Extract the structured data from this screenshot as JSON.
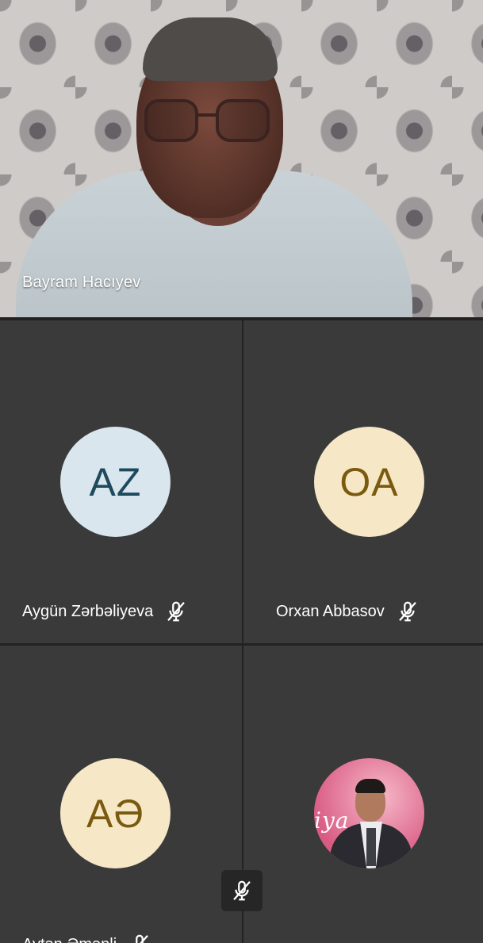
{
  "main_speaker": {
    "name": "Bayram Hacıyev"
  },
  "participants": [
    {
      "initials": "AZ",
      "name": "Aygün Zərbəliyeva",
      "avatar_bg": "#d9e6ed",
      "avatar_fg": "#1e4a5e",
      "muted": true
    },
    {
      "initials": "OA",
      "name": "Orxan Abbasov",
      "avatar_bg": "#f6e7c6",
      "avatar_fg": "#7a5a0e",
      "muted": true
    },
    {
      "initials": "AƏ",
      "name": "Aytən Əmənli",
      "name_visible": "Aytən Əmənli",
      "avatar_bg": "#f6e7c6",
      "avatar_fg": "#7a5a0e",
      "muted": true
    },
    {
      "photo": true,
      "photo_text": "iya",
      "name": ""
    }
  ],
  "icons": {
    "muted": "mic-off-icon"
  },
  "colors": {
    "background": "#222222",
    "tile": "#3a3a3a"
  }
}
